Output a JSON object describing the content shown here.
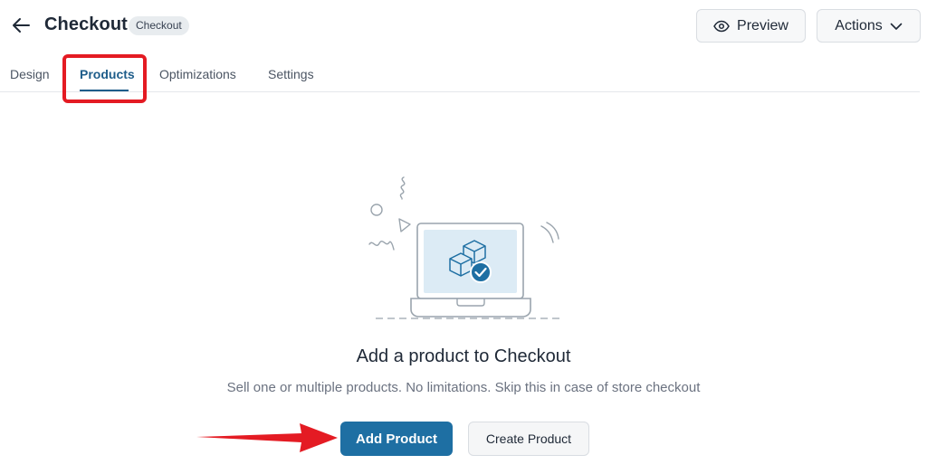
{
  "header": {
    "title": "Checkout",
    "badge": "Checkout",
    "preview_label": "Preview",
    "actions_label": "Actions"
  },
  "tabs": [
    {
      "label": "Design"
    },
    {
      "label": "Products",
      "active": true
    },
    {
      "label": "Optimizations"
    },
    {
      "label": "Settings"
    }
  ],
  "empty_state": {
    "title": "Add a product to Checkout",
    "subtitle": "Sell one or multiple products. No limitations. Skip this in case of store checkout",
    "add_label": "Add Product",
    "create_label": "Create Product"
  },
  "colors": {
    "accent": "#1e6fa3",
    "active_tab": "#1e5d8a",
    "annotation_red": "#e41b23"
  },
  "icons": [
    "back-arrow-icon",
    "eye-icon",
    "chevron-down-icon",
    "laptop-product-illustration",
    "check-circle-icon"
  ]
}
